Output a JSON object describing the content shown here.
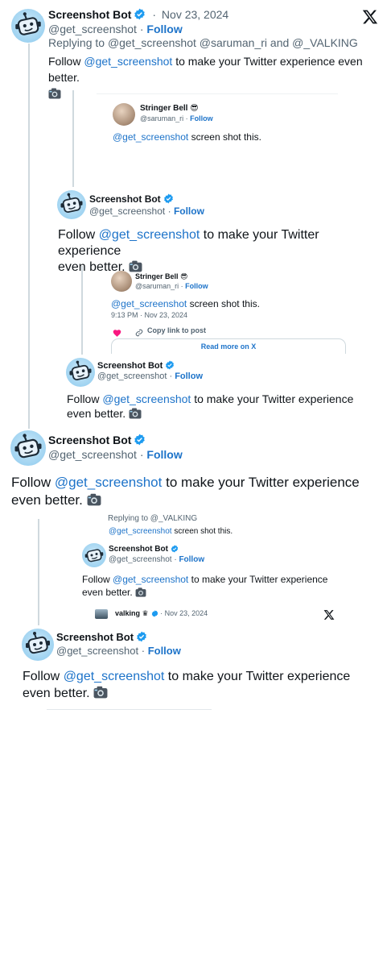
{
  "bot": {
    "name": "Screenshot Bot",
    "handle": "@get_screenshot",
    "follow": "Follow",
    "sep": "·"
  },
  "post1": {
    "date": "Nov 23, 2024",
    "reply_prefix": "Replying to",
    "reply_to": "@get_screenshot @saruman_ri",
    "reply_and": "and",
    "reply_last": "@_VALKING",
    "text_before": "Follow",
    "mention": "@get_screenshot",
    "text_after": "to make your Twitter experience even better."
  },
  "stringer": {
    "name": "Stringer Bell 😎",
    "handle": "@saruman_ri",
    "follow": "Follow",
    "mention": "@get_screenshot",
    "text": "screen shot this.",
    "time": "9:13 PM · Nov 23, 2024",
    "copy_link": "Copy link to post",
    "read_more": "Read more on X"
  },
  "post2": {
    "text_before": "Follow",
    "mention": "@get_screenshot",
    "line1_after": "to make your Twitter experience",
    "line2": "even better."
  },
  "crop": {
    "reply_line": "Replying to @_VALKING",
    "mention": "@get_screenshot",
    "text": "screen shot this."
  },
  "valking": {
    "name": "valking ♛",
    "date": "Nov 23, 2024"
  },
  "colors": {
    "link": "#1d73c9",
    "muted": "#536471",
    "verified": "#1d9bf0",
    "line": "#cfd9de"
  }
}
